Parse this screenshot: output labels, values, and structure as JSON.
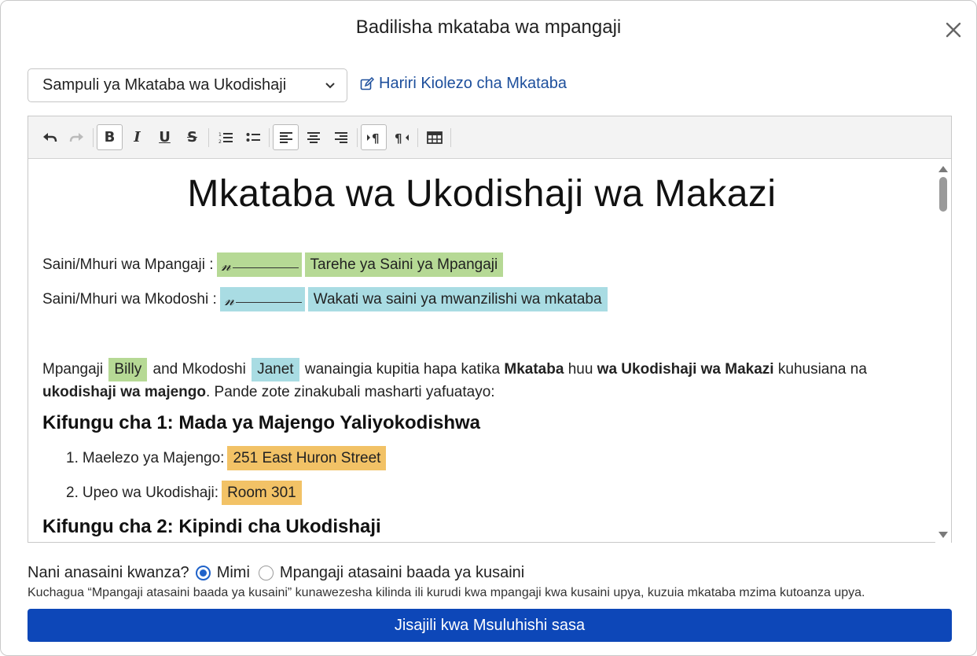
{
  "dialog": {
    "title": "Badilisha mkataba wa mpangaji"
  },
  "template": {
    "selected": "Sampuli ya Mkataba wa Ukodishaji",
    "edit_link": "Hariri Kiolezo cha Mkataba"
  },
  "toolbar": {
    "buttons": [
      "undo-icon",
      "redo-icon",
      "bold-icon",
      "italic-icon",
      "underline-icon",
      "strikethrough-icon",
      "ordered-list-icon",
      "bullet-list-icon",
      "align-left-icon",
      "align-center-icon",
      "align-right-icon",
      "ltr-icon",
      "rtl-icon",
      "table-icon"
    ],
    "bold": "B",
    "italic": "I",
    "underline": "U",
    "strike": "S"
  },
  "document": {
    "title": "Mkataba wa Ukodishaji wa Makazi",
    "tenant_sign_label": "Saini/Mhuri wa Mpangaji :",
    "tenant_date_tag": "Tarehe ya Saini ya Mpangaji",
    "landlord_sign_label": "Saini/Mhuri wa Mkodoshi :",
    "landlord_date_tag": "Wakati wa saini ya mwanzilishi wa mkataba",
    "sig_glyph": "𝓃",
    "para": {
      "t1": "Mpangaji",
      "tenant": "Billy",
      "t2": "and Mkodoshi",
      "landlord": "Janet",
      "t3": "wanaingia kupitia hapa katika",
      "b1": "Mkataba",
      "t4": "huu",
      "b2": "wa Ukodishaji wa Makazi",
      "t5": "kuhusiana na",
      "b3": "ukodishaji wa majengo",
      "t6": ". Pande zote zinakubali masharti yafuatayo:"
    },
    "section1": "Kifungu cha 1: Mada ya Majengo Yaliyokodishwa",
    "item1_num": "1.",
    "item1_label": "Maelezo ya Majengo:",
    "item1_value": "251 East Huron Street",
    "item2_num": "2.",
    "item2_label": "Upeo wa Ukodishaji:",
    "item2_value": "Room 301",
    "section2": "Kifungu cha 2: Kipindi cha Ukodishaji"
  },
  "signing": {
    "question": "Nani anasaini kwanza?",
    "option_me": "Mimi",
    "option_tenant": "Mpangaji atasaini baada ya kusaini",
    "hint": "Kuchagua “Mpangaji atasaini baada ya kusaini” kunawezesha kilinda ili kurudi kwa mpangaji kwa kusaini upya, kuzuia mkataba mzima kutoanza upya."
  },
  "submit": {
    "label": "Jisajili kwa Msuluhishi sasa"
  },
  "colors": {
    "accent": "#0d47b8",
    "link": "#1d4f9c",
    "tag_green": "#b6d995",
    "tag_blue": "#a9dce3",
    "tag_orange": "#f2c266"
  }
}
